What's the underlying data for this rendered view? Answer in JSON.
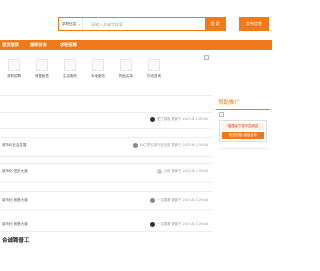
{
  "header": {
    "search_category": "求职信息 ⌄",
    "search_placeholder": "请输入关键字搜索",
    "search_button": "搜 索",
    "post_button": "发布信息"
  },
  "nav": {
    "items": [
      "首页推荐",
      "兼职任务",
      "求职招聘"
    ]
  },
  "categories": [
    {
      "label": "求职招聘",
      "icon": "category-icon"
    },
    {
      "label": "房屋租售",
      "icon": "category-icon"
    },
    {
      "label": "生活服务",
      "icon": "category-icon"
    },
    {
      "label": "本地服务",
      "icon": "category-icon"
    },
    {
      "label": "物品买卖",
      "icon": "category-icon"
    },
    {
      "label": "在线咨询",
      "icon": "category-icon"
    }
  ],
  "rows": [
    {
      "title": "",
      "author": "肥丁猫喵",
      "time": "更新于 2023-6-1 09:00",
      "avatar": "dark"
    },
    {
      "title": "城市化社会发展",
      "author": "AA之梦幻旅行社总部",
      "time": "更新于 2023-6-1 09:00",
      "avatar": "gray"
    },
    {
      "title": "城市化·进步大道",
      "author": "小帆",
      "time": "更新于 2023-6-1 09:00",
      "avatar": "light"
    },
    {
      "title": "城市化·我是大道",
      "author": "一定要看",
      "time": "更新于 2023-6-1 09:00",
      "avatar": "gray"
    },
    {
      "title": "城市化·我是大道",
      "author": "一定要看",
      "time": "更新于 2023-6-1 09:00",
      "avatar": "dark"
    }
  ],
  "section_title": "合诚聘普工",
  "sidebar": {
    "title": "赞助推广",
    "banner_line1": "福建省宁德市霞浦县",
    "banner_line2": "欢迎光临 诚信合作"
  },
  "colors": {
    "accent": "#f07a1a"
  }
}
